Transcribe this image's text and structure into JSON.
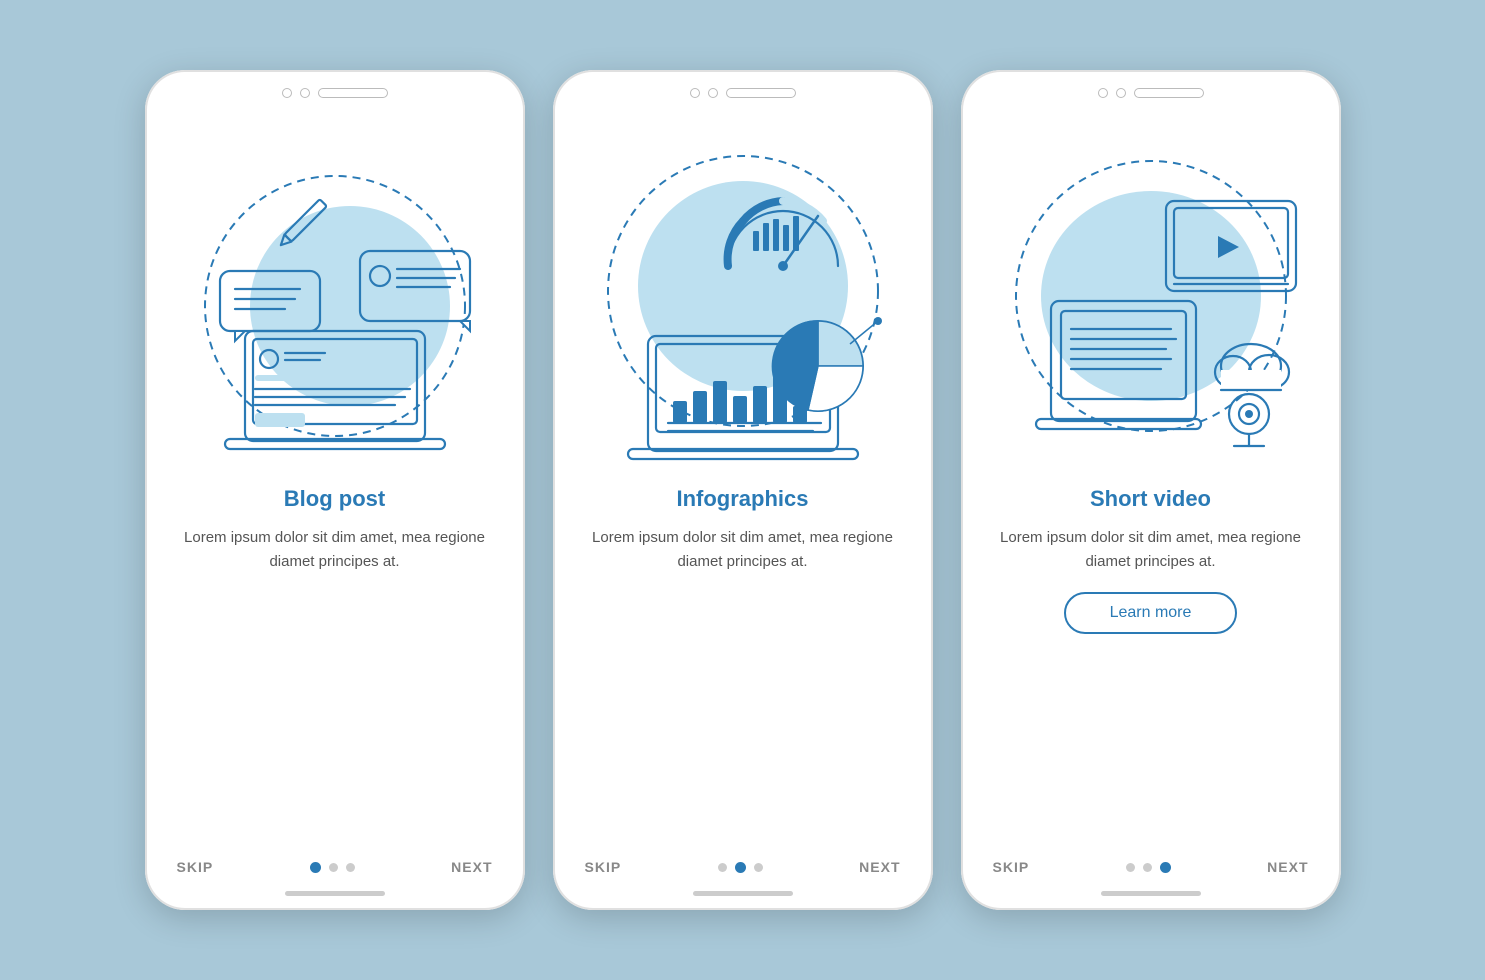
{
  "background": "#a8c8d8",
  "phones": [
    {
      "id": "blog-post",
      "title": "Blog post",
      "description": "Lorem ipsum dolor sit dim amet, mea regione diamet principes at.",
      "nav": {
        "skip": "SKIP",
        "next": "NEXT",
        "dots": [
          {
            "active": true
          },
          {
            "active": false
          },
          {
            "active": false
          }
        ]
      },
      "hasLearnMore": false
    },
    {
      "id": "infographics",
      "title": "Infographics",
      "description": "Lorem ipsum dolor sit dim amet, mea regione diamet principes at.",
      "nav": {
        "skip": "SKIP",
        "next": "NEXT",
        "dots": [
          {
            "active": false
          },
          {
            "active": true
          },
          {
            "active": false
          }
        ]
      },
      "hasLearnMore": false
    },
    {
      "id": "short-video",
      "title": "Short video",
      "description": "Lorem ipsum dolor sit dim amet, mea regione diamet principes at.",
      "nav": {
        "skip": "SKIP",
        "next": "NEXT",
        "dots": [
          {
            "active": false
          },
          {
            "active": false
          },
          {
            "active": true
          }
        ]
      },
      "hasLearnMore": true,
      "learnMoreLabel": "Learn more"
    }
  ]
}
